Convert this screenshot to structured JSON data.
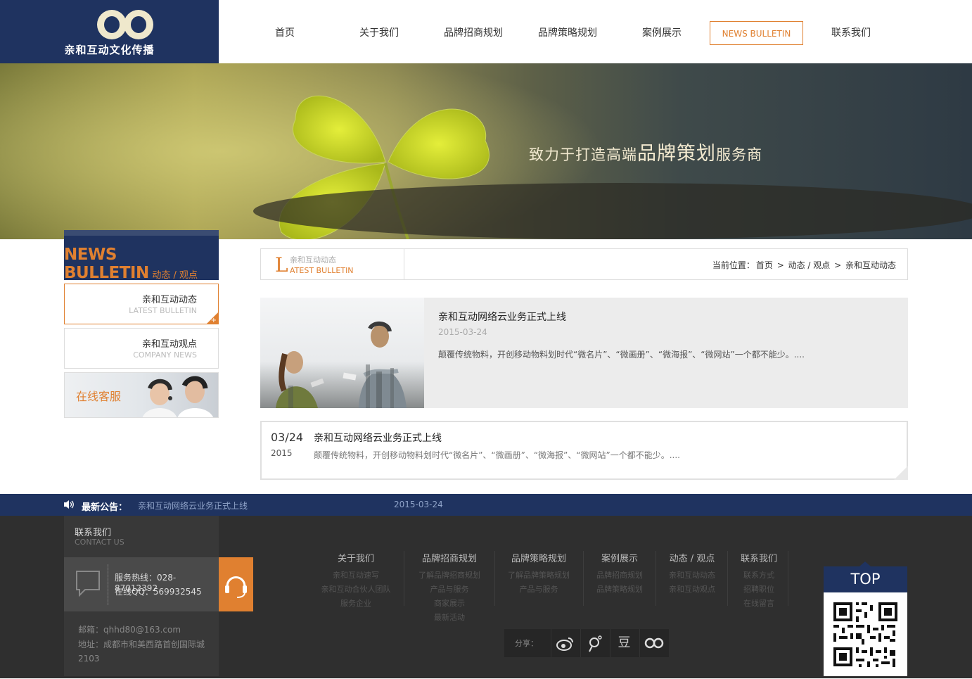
{
  "brand": {
    "name": "亲和互动文化传播"
  },
  "nav": {
    "items": [
      {
        "label": "首页"
      },
      {
        "label": "关于我们"
      },
      {
        "label": "品牌招商规划"
      },
      {
        "label": "品牌策略规划"
      },
      {
        "label": "案例展示"
      },
      {
        "label": "NEWS BULLETIN"
      },
      {
        "label": "联系我们"
      }
    ],
    "active_index": 5
  },
  "banner": {
    "slogan_prefix": "致力于打造高端",
    "slogan_big": "品牌策划",
    "slogan_suffix": "服务商"
  },
  "sidebar": {
    "title": "NEWS BULLETIN",
    "subtitle": "动态 / 观点",
    "items": [
      {
        "label": "亲和互动动态",
        "en": "LATEST BULLETIN",
        "active": true
      },
      {
        "label": "亲和互动观点",
        "en": "COMPANY NEWS",
        "active": false
      }
    ],
    "service_label": "在线客服"
  },
  "section": {
    "letter": "L",
    "title_cn": "亲和互动动态",
    "title_en": "ATEST BULLETIN",
    "breadcrumb": {
      "prefix": "当前位置：",
      "items": [
        "首页",
        "动态 / 观点",
        "亲和互动动态"
      ],
      "separator": ">"
    }
  },
  "feature": {
    "title": "亲和互动网络云业务正式上线",
    "date": "2015-03-24",
    "desc": "颠覆传统物料，开创移动物料划时代“微名片”、“微画册”、“微海报”、“微网站”一个都不能少。...."
  },
  "list": [
    {
      "day": "03/24",
      "year": "2015",
      "title": "亲和互动网络云业务正式上线",
      "desc": "颠覆传统物料，开创移动物料划时代“微名片”、“微画册”、“微海报”、“微网站”一个都不能少。...."
    }
  ],
  "notice": {
    "label": "最新公告：",
    "text": "亲和互动网络云业务正式上线",
    "date": "2015-03-24"
  },
  "footer": {
    "contact": {
      "title": "联系我们",
      "subtitle": "CONTACT US",
      "hotline": "服务热线：028-87012392",
      "qq": "在线QQ：569932545",
      "mail": "邮箱：qhhd80@163.com",
      "address": "地址：成都市和美西路首创国际城2103"
    },
    "columns": [
      {
        "title": "关于我们",
        "items": [
          "亲和互动速写",
          "亲和互动合伙人团队",
          "服务企业"
        ]
      },
      {
        "title": "品牌招商规划",
        "items": [
          "了解品牌招商规划",
          "产品与服务",
          "商家展示",
          "最新活动"
        ]
      },
      {
        "title": "品牌策略规划",
        "items": [
          "了解品牌策略规划",
          "产品与服务"
        ]
      },
      {
        "title": "案例展示",
        "items": [
          "品牌招商规划",
          "品牌策略规划"
        ]
      },
      {
        "title": "动态 / 观点",
        "items": [
          "亲和互动动态",
          "亲和互动观点"
        ]
      },
      {
        "title": "联系我们",
        "items": [
          "联系方式",
          "招聘职位",
          "在线留言"
        ]
      }
    ],
    "share": {
      "label": "分享：",
      "buttons": [
        {
          "icon": "weibo-icon"
        },
        {
          "icon": "tencent-weibo-icon"
        },
        {
          "icon": "douban-icon",
          "glyph": "豆"
        },
        {
          "icon": "renren-icon"
        }
      ]
    },
    "top_label": "TOP"
  },
  "colors": {
    "navy": "#1f3360",
    "accent": "#e08030",
    "footer_bg": "#2f2f2f"
  }
}
